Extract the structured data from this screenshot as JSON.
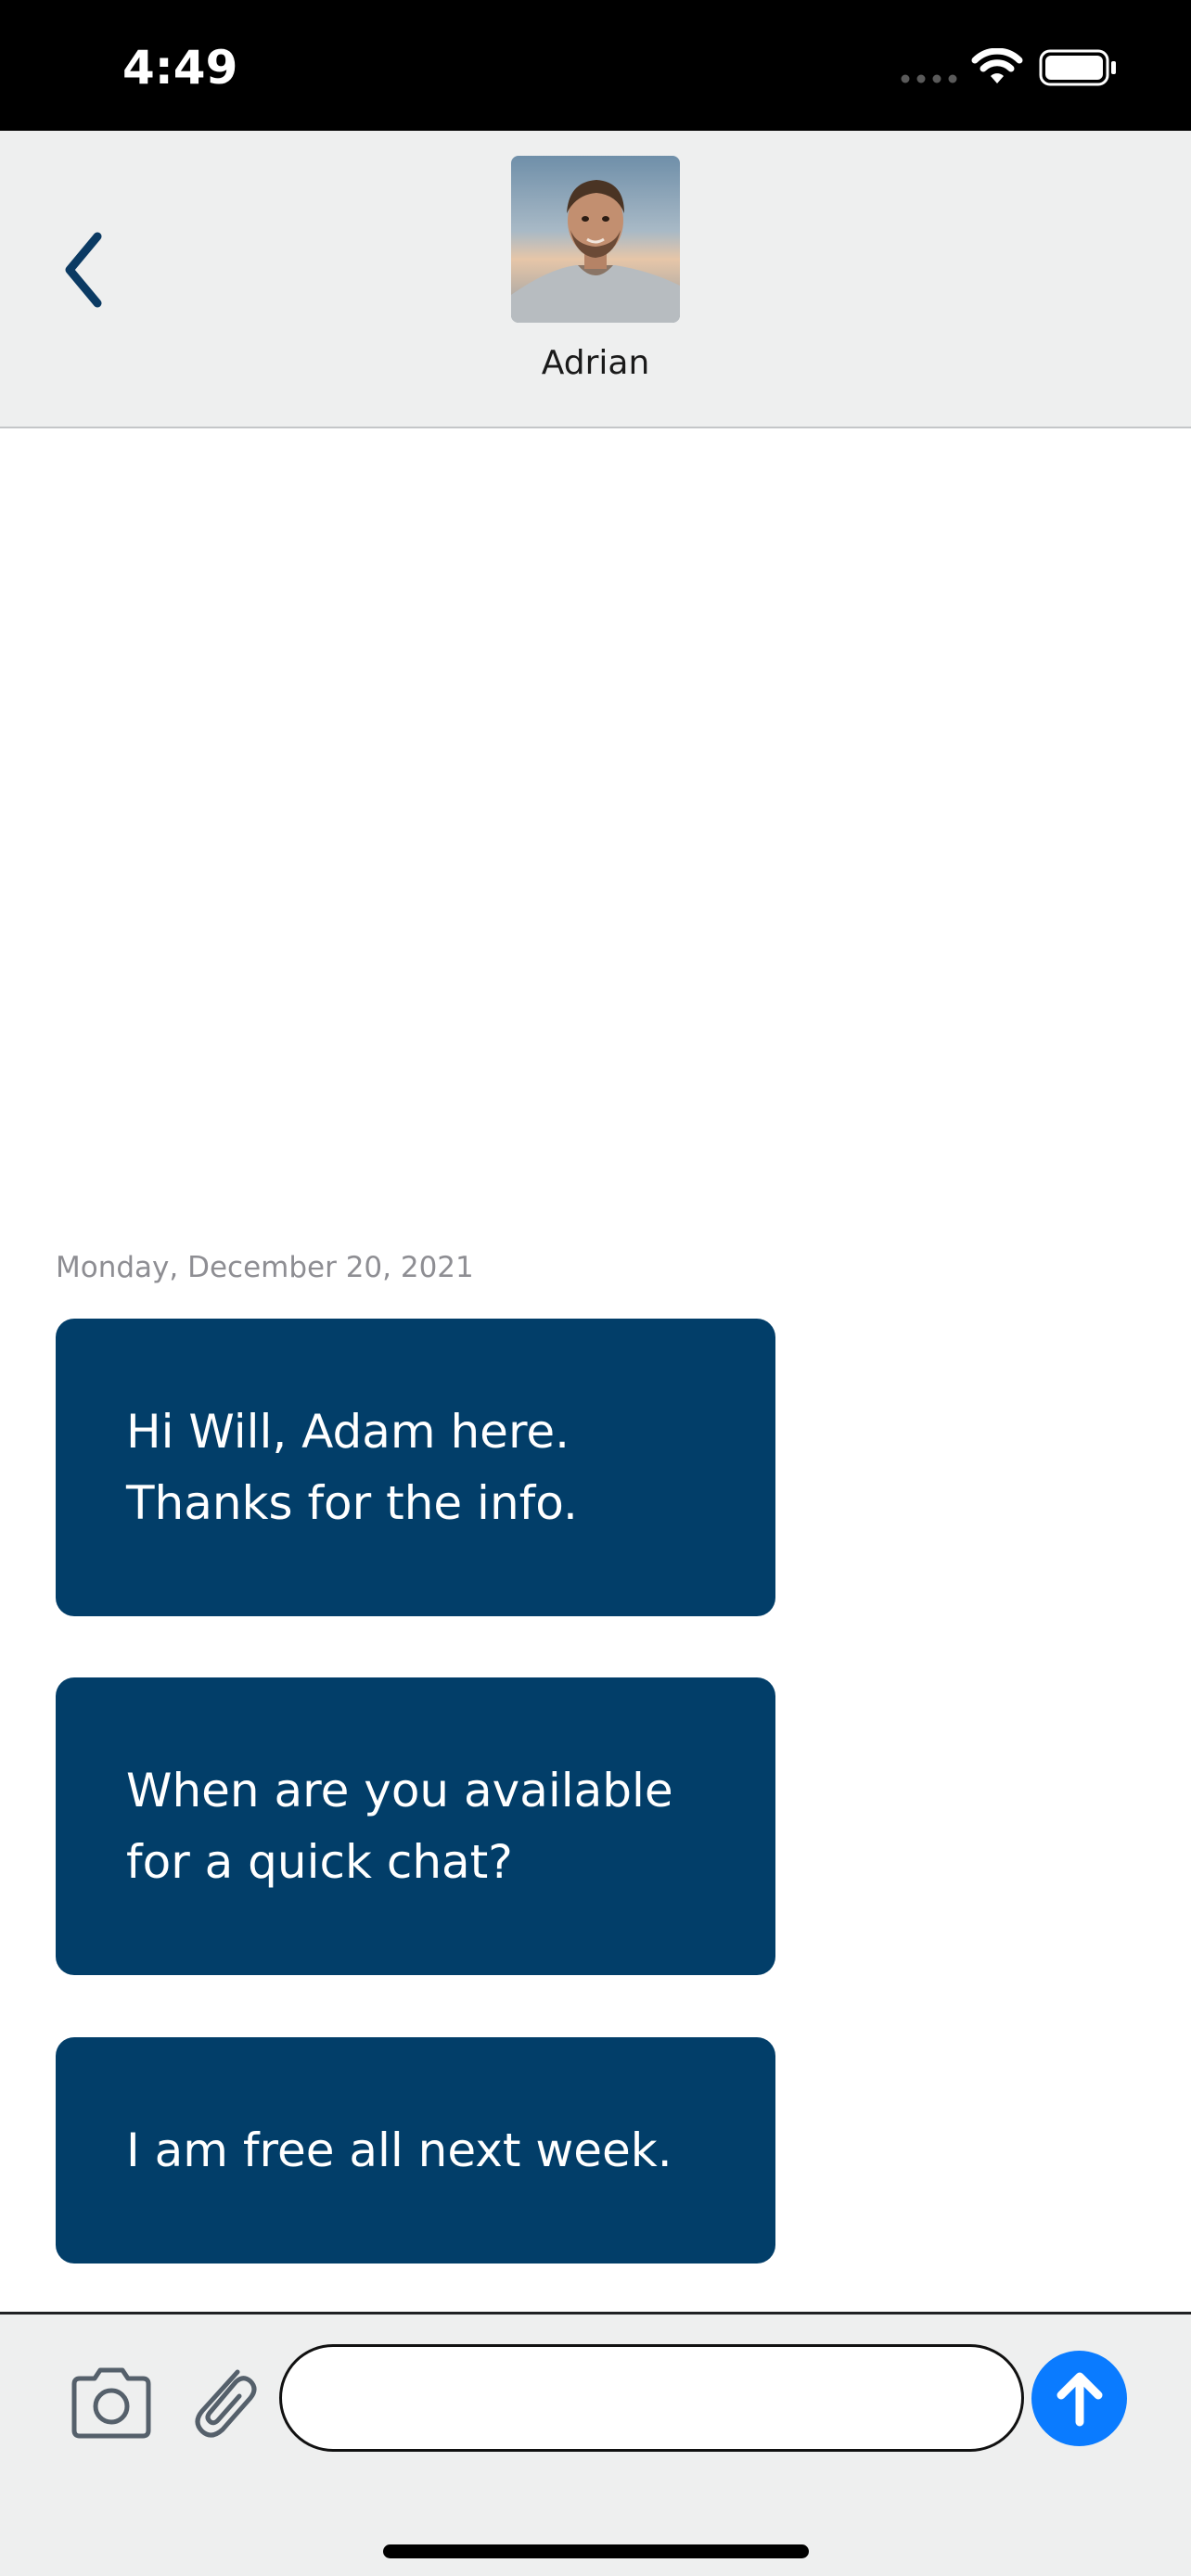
{
  "status_bar": {
    "time": "4:49",
    "icons": [
      "cellular-signal-icon",
      "wifi-icon",
      "battery-icon"
    ]
  },
  "header": {
    "back_icon": "chevron-left-icon",
    "contact_name": "Adrian",
    "avatar": "contact-photo"
  },
  "conversation": {
    "date": "Monday, December 20, 2021",
    "messages": [
      {
        "text": "Hi Will, Adam here.\nThanks for the info."
      },
      {
        "text": "When are you available\nfor a quick chat?"
      },
      {
        "text": "I am free all next week."
      }
    ]
  },
  "composer": {
    "camera_icon": "camera-icon",
    "attach_icon": "paperclip-icon",
    "input_value": "",
    "send_icon": "arrow-up-icon"
  },
  "colors": {
    "bubble": "#023e69",
    "header_background": "#eeefef",
    "accent": "#0a7bff",
    "back_chevron": "#0b3a63"
  }
}
